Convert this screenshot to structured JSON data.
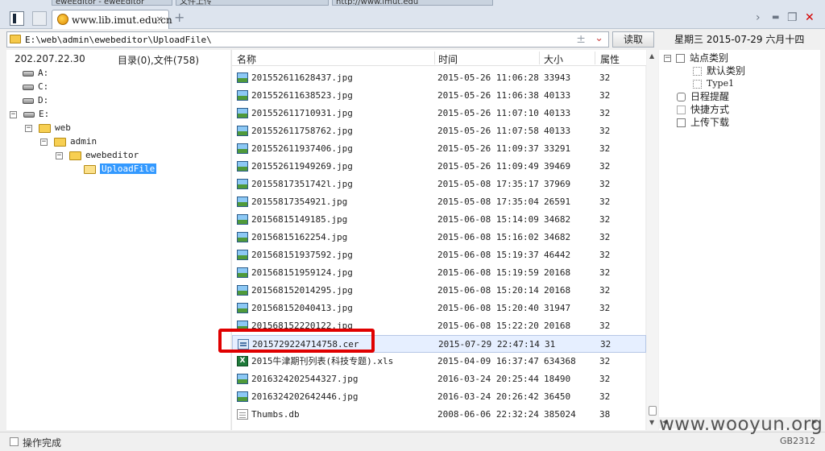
{
  "tabs": {
    "partial": [
      "eweEditor - eweEditor",
      "文件上传",
      "http://www.imut.edu"
    ],
    "active_title": "www.lib.imut.edu.cn",
    "close_glyph": "×",
    "new_tab_glyph": "+"
  },
  "window": {
    "chevron": "›",
    "minimize": "▬",
    "maximize": "❐",
    "close": "✕",
    "close_color": "#d40000"
  },
  "address": {
    "path": "E:\\web\\admin\\ewebeditor\\UploadFile\\",
    "plus_minus": "±",
    "dropdown": "⌄"
  },
  "read_button": "读取",
  "date_line": "星期三 2015-07-29 六月十四",
  "left": {
    "ip": "202.207.22.30",
    "dircount": "目录(0),文件(758)",
    "tree": [
      {
        "label": "A:",
        "type": "drive",
        "toggle": ""
      },
      {
        "label": "C:",
        "type": "drive",
        "toggle": ""
      },
      {
        "label": "D:",
        "type": "drive",
        "toggle": ""
      },
      {
        "label": "E:",
        "type": "drive",
        "toggle": "−"
      },
      {
        "label": "web",
        "type": "folder",
        "toggle": "−"
      },
      {
        "label": "admin",
        "type": "folder",
        "toggle": "−"
      },
      {
        "label": "ewebeditor",
        "type": "folder",
        "toggle": "−"
      },
      {
        "label": "UploadFile",
        "type": "folder-open",
        "toggle": ""
      }
    ]
  },
  "list": {
    "headers": {
      "name": "名称",
      "time": "时间",
      "size": "大小",
      "attr": "属性"
    },
    "rows": [
      {
        "icon": "image-icon",
        "name": "201552611628437.jpg",
        "time": "2015-05-26 11:06:28",
        "size": "33943",
        "attr": "32"
      },
      {
        "icon": "image-icon",
        "name": "201552611638523.jpg",
        "time": "2015-05-26 11:06:38",
        "size": "40133",
        "attr": "32"
      },
      {
        "icon": "image-icon",
        "name": "201552611710931.jpg",
        "time": "2015-05-26 11:07:10",
        "size": "40133",
        "attr": "32"
      },
      {
        "icon": "image-icon",
        "name": "201552611758762.jpg",
        "time": "2015-05-26 11:07:58",
        "size": "40133",
        "attr": "32"
      },
      {
        "icon": "image-icon",
        "name": "201552611937406.jpg",
        "time": "2015-05-26 11:09:37",
        "size": "33291",
        "attr": "32"
      },
      {
        "icon": "image-icon",
        "name": "201552611949269.jpg",
        "time": "2015-05-26 11:09:49",
        "size": "39469",
        "attr": "32"
      },
      {
        "icon": "image-icon",
        "name": "20155817351742l.jpg",
        "time": "2015-05-08 17:35:17",
        "size": "37969",
        "attr": "32"
      },
      {
        "icon": "image-icon",
        "name": "20155817354921.jpg",
        "time": "2015-05-08 17:35:04",
        "size": "26591",
        "attr": "32"
      },
      {
        "icon": "image-icon",
        "name": "20156815149185.jpg",
        "time": "2015-06-08 15:14:09",
        "size": "34682",
        "attr": "32"
      },
      {
        "icon": "image-icon",
        "name": "20156815162254.jpg",
        "time": "2015-06-08 15:16:02",
        "size": "34682",
        "attr": "32"
      },
      {
        "icon": "image-icon",
        "name": "201568151937592.jpg",
        "time": "2015-06-08 15:19:37",
        "size": "46442",
        "attr": "32"
      },
      {
        "icon": "image-icon",
        "name": "201568151959124.jpg",
        "time": "2015-06-08 15:19:59",
        "size": "20168",
        "attr": "32"
      },
      {
        "icon": "image-icon",
        "name": "201568152014295.jpg",
        "time": "2015-06-08 15:20:14",
        "size": "20168",
        "attr": "32"
      },
      {
        "icon": "image-icon",
        "name": "201568152040413.jpg",
        "time": "2015-06-08 15:20:40",
        "size": "31947",
        "attr": "32"
      },
      {
        "icon": "image-icon",
        "name": "201568152220122.jpg",
        "time": "2015-06-08 15:22:20",
        "size": "20168",
        "attr": "32"
      },
      {
        "icon": "cert-icon",
        "name": "2015729224714758.cer",
        "time": "2015-07-29 22:47:14",
        "size": "31",
        "attr": "32",
        "selected": true
      },
      {
        "icon": "excel-icon",
        "name": "2015牛津期刊列表(科技专题).xls",
        "time": "2015-04-09 16:37:47",
        "size": "634368",
        "attr": "32"
      },
      {
        "icon": "image-icon",
        "name": "2016324202544327.jpg",
        "time": "2016-03-24 20:25:44",
        "size": "18490",
        "attr": "32"
      },
      {
        "icon": "image-icon",
        "name": "2016324202642446.jpg",
        "time": "2016-03-24 20:26:42",
        "size": "36450",
        "attr": "32"
      },
      {
        "icon": "db-file-icon",
        "name": "Thumbs.db",
        "time": "2008-06-06 22:32:24",
        "size": "385024",
        "attr": "38"
      }
    ]
  },
  "right": {
    "items": [
      {
        "label": "站点类别",
        "toggle": "−",
        "icon": "box",
        "indent": 0
      },
      {
        "label": "默认类别",
        "toggle": "",
        "icon": "dotted-box",
        "indent": 1
      },
      {
        "label": "Type1",
        "toggle": "",
        "icon": "dotted-box",
        "indent": 1
      },
      {
        "label": "日程提醒",
        "toggle": "",
        "icon": "clock",
        "indent": 0
      },
      {
        "label": "快捷方式",
        "toggle": "",
        "icon": "page",
        "indent": 0
      },
      {
        "label": "上传下载",
        "toggle": "",
        "icon": "box",
        "indent": 0
      }
    ]
  },
  "status": {
    "text": "操作完成",
    "encoding": "GB2312"
  },
  "watermark": "www.wooyun.org",
  "highlight_color": "#e00000"
}
